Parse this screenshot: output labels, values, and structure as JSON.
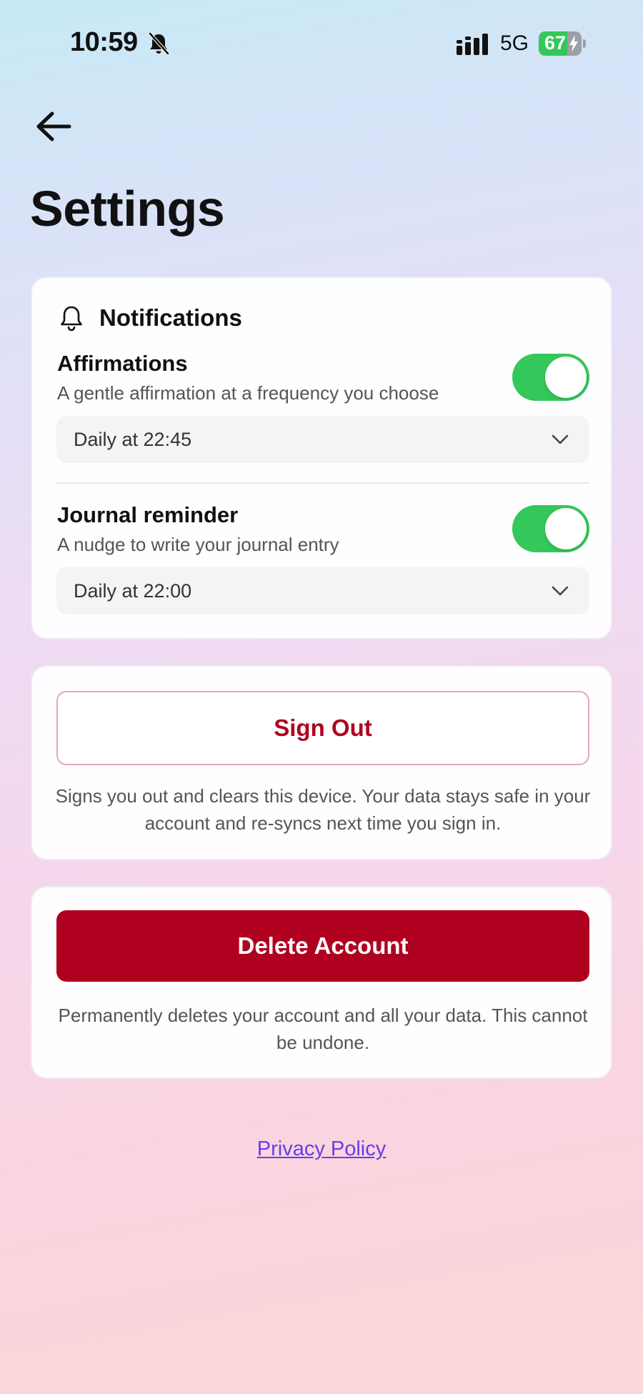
{
  "status_bar": {
    "time": "10:59",
    "network": "5G",
    "battery_level": "67",
    "battery_fraction": 0.67,
    "accent": "#34c759",
    "icons": [
      "bell-off-icon",
      "signal-icon",
      "battery-charging-icon"
    ]
  },
  "header": {
    "back_icon": "arrow-left-icon",
    "title": "Settings"
  },
  "notifications": {
    "section_title": "Notifications",
    "section_icon": "bell-icon",
    "items": [
      {
        "title": "Affirmations",
        "description": "A gentle affirmation at a frequency you choose",
        "enabled": true,
        "schedule": "Daily at 22:45"
      },
      {
        "title": "Journal reminder",
        "description": "A nudge to write your journal entry",
        "enabled": true,
        "schedule": "Daily at 22:00"
      }
    ]
  },
  "sign_out": {
    "label": "Sign Out",
    "note": "Signs you out and clears this device. Your data stays safe in your account and re-syncs next time you sign in."
  },
  "delete_account": {
    "label": "Delete Account",
    "note": "Permanently deletes your account and all your data. This cannot be undone.",
    "color": "#b00020"
  },
  "footer": {
    "privacy_link": "Privacy Policy",
    "link_color": "#6a3de8"
  }
}
